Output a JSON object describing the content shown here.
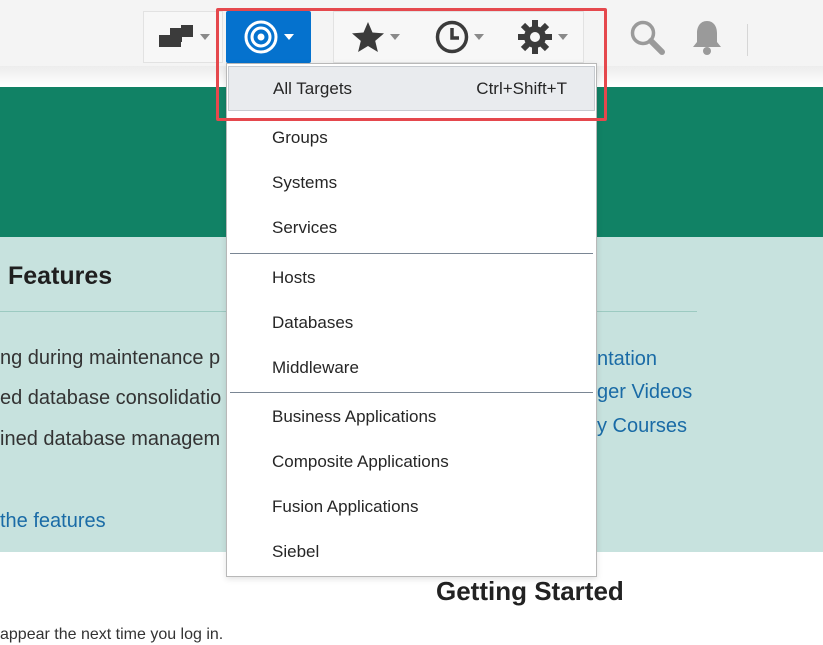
{
  "toolbar": {
    "items": [
      "enterprise-icon",
      "targets-icon",
      "favorites-icon",
      "history-icon",
      "setup-icon",
      "search-icon",
      "notifications-icon"
    ],
    "accent_color": "#0572ce"
  },
  "menu": {
    "items": [
      {
        "label": "All Targets",
        "shortcut": "Ctrl+Shift+T"
      },
      {
        "label": "Groups"
      },
      {
        "label": "Systems"
      },
      {
        "label": "Services"
      },
      {
        "label": "Hosts"
      },
      {
        "label": "Databases"
      },
      {
        "label": "Middleware"
      },
      {
        "label": "Business Applications"
      },
      {
        "label": "Composite Applications"
      },
      {
        "label": "Fusion Applications"
      },
      {
        "label": "Siebel"
      }
    ]
  },
  "page": {
    "features_title": "Features",
    "features": [
      "ng during maintenance p",
      "ed database consolidatio",
      "ined database managem"
    ],
    "features_link": "the features",
    "links": [
      "ntation",
      "ger Videos",
      "y Courses"
    ],
    "getting_started": "Getting Started",
    "footnote": "appear the next time you log in.",
    "colors": {
      "hero": "#118265",
      "band": "#c7e2de",
      "link": "#1a6ba6",
      "highlight": "#e5484d"
    }
  }
}
